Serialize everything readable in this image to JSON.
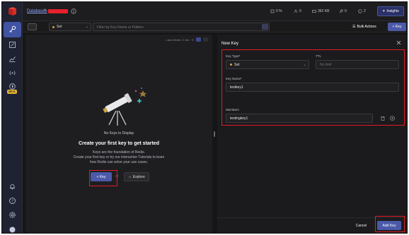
{
  "app": {
    "breadcrumb": "Databases",
    "breadcrumb_sep": ">"
  },
  "stats": [
    {
      "icon": "cpu-icon",
      "value": "0 %"
    },
    {
      "icon": "ops-icon",
      "value": "0"
    },
    {
      "icon": "memory-icon",
      "value": "362 KB"
    },
    {
      "icon": "keys-icon",
      "value": "0"
    },
    {
      "icon": "clients-icon",
      "value": "2"
    }
  ],
  "topbar": {
    "insights_label": "Insights"
  },
  "filter": {
    "type_value": "Set",
    "search_placeholder": "Filter by Key Name or Pattern",
    "bulk_actions_label": "Bulk Actions",
    "add_key_label": "+ Key"
  },
  "rail": {
    "badge": "BETA"
  },
  "left_panel": {
    "refresh_text": "Last refresh: 2 min",
    "no_keys": "No Keys to Display",
    "heading": "Create your first key to get started",
    "body_line1": "Keys are the foundation of Redis.",
    "body_line2": "Create your first key or try our interactive Tutorials to learn",
    "body_line3": "how Redis can solve your use cases.",
    "add_key_label": "+ Key",
    "or_text": "or",
    "explore_label": "Explore"
  },
  "new_key": {
    "title": "New Key",
    "key_type_label": "Key Type*",
    "key_type_value": "Set",
    "ttl_label": "TTL",
    "ttl_placeholder": "No limit",
    "key_name_label": "Key Name*",
    "key_name_value": "testkey1",
    "members_label": "Members",
    "member_value": "testingkey1",
    "cancel_label": "Cancel",
    "add_key_label": "Add Key"
  },
  "colors": {
    "accent": "#4b59a8",
    "highlight": "#e01b24",
    "set_dot": "#d6a437",
    "beta": "#e6b532"
  }
}
